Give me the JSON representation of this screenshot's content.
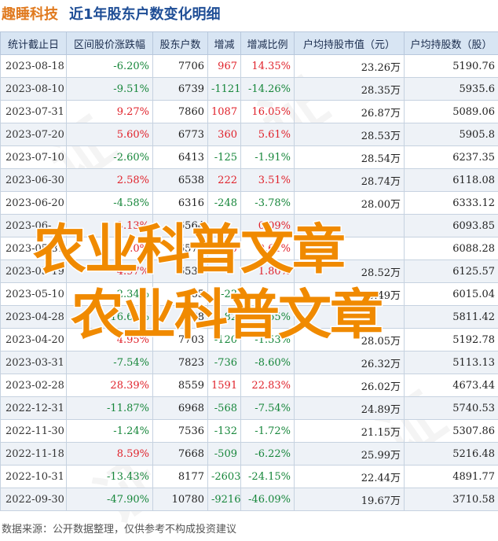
{
  "header": {
    "company": "趣睡科技",
    "title": "近1年股东户数变化明细"
  },
  "table": {
    "columns": [
      "统计截止日",
      "区间股价涨跌幅",
      "股东户数",
      "增减",
      "增减比例",
      "户均持股市值（元）",
      "户均持股数（股）"
    ],
    "rows": [
      [
        "2023-08-18",
        "-6.20%",
        "7706",
        "967",
        "14.35%",
        "23.26万",
        "5190.76"
      ],
      [
        "2023-08-10",
        "-9.51%",
        "6739",
        "-1121",
        "-14.26%",
        "28.35万",
        "5935.6"
      ],
      [
        "2023-07-31",
        "9.27%",
        "7860",
        "1087",
        "16.05%",
        "26.87万",
        "5089.06"
      ],
      [
        "2023-07-20",
        "5.60%",
        "6773",
        "360",
        "5.61%",
        "28.53万",
        "5905.8"
      ],
      [
        "2023-07-10",
        "-2.60%",
        "6413",
        "-125",
        "-1.91%",
        "28.54万",
        "6237.35"
      ],
      [
        "2023-06-30",
        "2.58%",
        "6538",
        "222",
        "3.51%",
        "28.74万",
        "6118.08"
      ],
      [
        "2023-06-20",
        "-4.58%",
        "6316",
        "-248",
        "-3.78%",
        "28.00万",
        "6333.12"
      ],
      [
        "2023-06-",
        "3.13%",
        "6564",
        "",
        "0.09%",
        "",
        "6093.85"
      ],
      [
        "2023-05-31",
        "0.0%",
        "6570",
        "40",
        "0.61%",
        "",
        "6088.28"
      ],
      [
        "2023-05-19",
        "4.97%",
        "6530",
        "",
        "1.80%",
        "28.52万",
        "6125.57"
      ],
      [
        "2023-05-10",
        "-2.34%",
        "665",
        "-23",
        "",
        "28.49万",
        "6015.04"
      ],
      [
        "2023-04-28",
        "-16.60%",
        "68",
        "-82",
        "-10.65%",
        "",
        "5811.42"
      ],
      [
        "2023-04-20",
        "4.95%",
        "7703",
        "-120",
        "-1.53%",
        "28.05万",
        "5192.78"
      ],
      [
        "2023-03-31",
        "-7.54%",
        "7823",
        "-736",
        "-8.60%",
        "26.32万",
        "5113.13"
      ],
      [
        "2023-02-28",
        "28.39%",
        "8559",
        "1591",
        "22.83%",
        "26.02万",
        "4673.44"
      ],
      [
        "2022-12-31",
        "-11.87%",
        "6968",
        "-568",
        "-7.54%",
        "24.89万",
        "5740.53"
      ],
      [
        "2022-11-30",
        "-1.24%",
        "7536",
        "-132",
        "-1.72%",
        "21.15万",
        "5307.86"
      ],
      [
        "2022-11-18",
        "8.59%",
        "7668",
        "-509",
        "-6.22%",
        "25.99万",
        "5216.48"
      ],
      [
        "2022-10-31",
        "-13.43%",
        "8177",
        "-2603",
        "-24.15%",
        "22.44万",
        "4891.77"
      ],
      [
        "2022-09-30",
        "-47.90%",
        "10780",
        "-9216",
        "-46.09%",
        "19.67万",
        "3710.58"
      ]
    ]
  },
  "overlay": {
    "line1": "农业科普文章",
    "line2": "农业科普文章"
  },
  "footer": {
    "source": "数据来源：公开数据整理，仅供参考不构成投资建议"
  },
  "colors": {
    "positive": "#e0222b",
    "negative": "#16863a",
    "header_bg": "#d8e5f3",
    "company": "#e07a1f",
    "title": "#1f4e96",
    "overlay": "#f08a00"
  }
}
